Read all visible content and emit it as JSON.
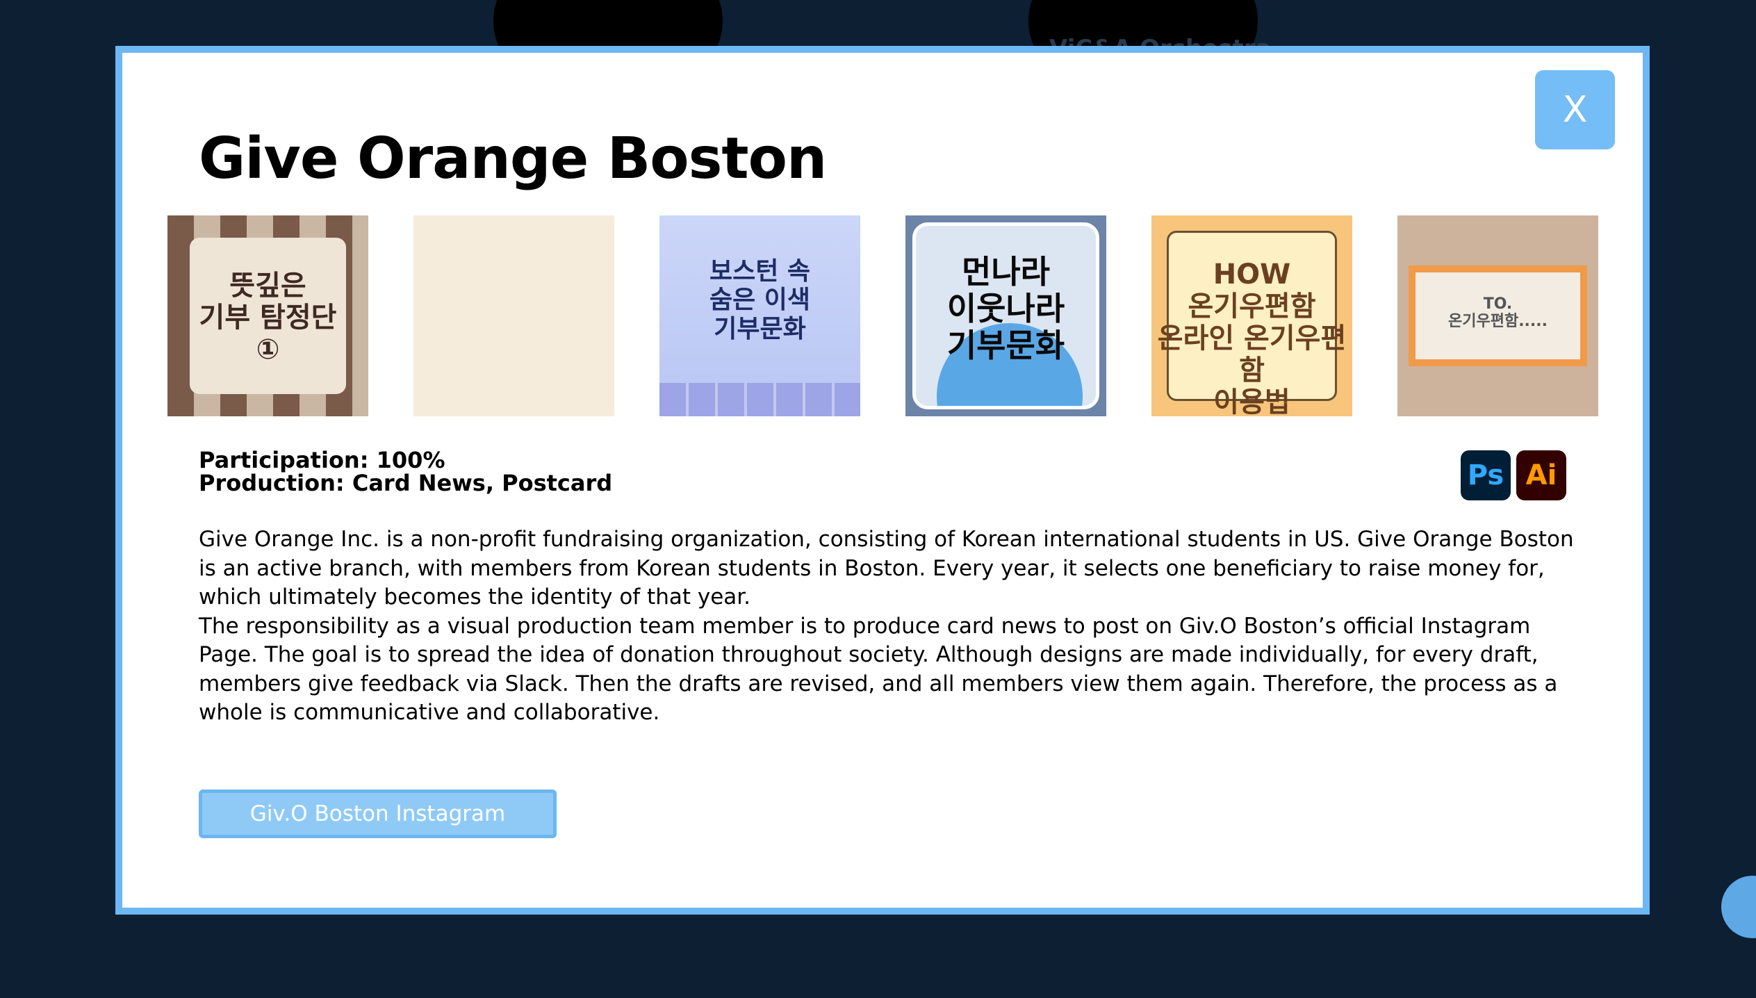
{
  "background": {
    "faint_text": "ViC&A Orchestra"
  },
  "modal": {
    "close_label": "X",
    "title": "Give Orange Boston",
    "gallery": [
      {
        "text": "뜻깊은\n기부 탐정단\n①"
      },
      {
        "text": ""
      },
      {
        "text": "보스턴 속\n숨은 이색\n기부문화"
      },
      {
        "text": "먼나라\n이웃나라\n기부문화"
      },
      {
        "text": "HOW\n온기우편함\n온라인 온기우편함\n이용법"
      },
      {
        "text": "TO.\n온기우편함....."
      }
    ],
    "participation": "Participation: 100%",
    "production": "Production: Card News, Postcard",
    "tools": [
      {
        "label": "Ps",
        "icon": "photoshop-icon"
      },
      {
        "label": "Ai",
        "icon": "illustrator-icon"
      }
    ],
    "description": [
      "Give Orange Inc. is a non-profit fundraising organization, consisting of Korean international students in US. Give Orange Boston is an active branch, with members from Korean students in Boston. Every year, it selects one beneficiary to raise money for, which ultimately becomes the identity of that year.",
      "The responsibility as a visual production team member is to produce card news to post on Giv.O Boston’s official Instagram Page. The goal is to spread the idea of donation throughout society. Although designs are made individually, for every draft, members give feedback via Slack. Then the drafts are revised, and all members view them again. Therefore, the process as a whole is communicative and collaborative."
    ],
    "instagram_button": "Giv.O Boston Instagram"
  }
}
